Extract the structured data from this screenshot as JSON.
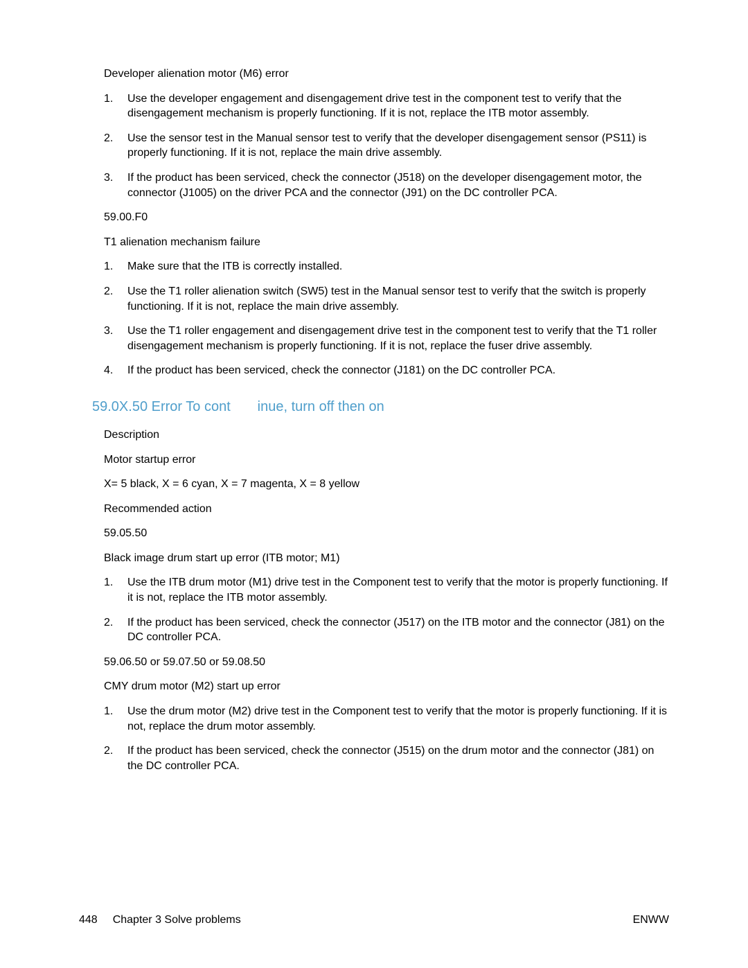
{
  "section1": {
    "title": "Developer alienation motor (M6) error",
    "items": [
      "Use the developer engagement and disengagement drive test in the component test to verify that the disengagement mechanism is properly functioning. If it is not, replace the ITB motor assembly.",
      "Use the sensor test in the Manual sensor test to verify that the developer disengagement sensor (PS11) is properly functioning. If it is not, replace the main drive assembly.",
      "If the product has been serviced, check the connector (J518) on the developer disengagement motor, the connector (J1005) on the driver PCA and the connector (J91) on the DC controller PCA."
    ]
  },
  "section2": {
    "code": "59.00.F0",
    "title": "T1 alienation mechanism failure",
    "items": [
      "Make sure that the ITB is correctly installed.",
      "Use the T1 roller alienation switch (SW5) test in the Manual sensor test to verify that the switch is properly functioning. If it is not, replace the main drive assembly.",
      "Use the T1 roller engagement and disengagement drive test in the component test to verify that the T1 roller disengagement mechanism is properly functioning. If it is not, replace the fuser drive assembly.",
      "If the product has been serviced, check the connector (J181) on the DC controller PCA."
    ]
  },
  "heading2": "59.0X.50 Error To cont       inue, turn off then on",
  "section3": {
    "desc_label": "Description",
    "desc_text1": "Motor startup error",
    "desc_text2": "X= 5 black, X = 6 cyan, X = 7 magenta, X = 8 yellow",
    "rec_label": "Recommended action"
  },
  "section4": {
    "code": "59.05.50",
    "title": "Black image drum start up error (ITB motor; M1)",
    "items": [
      "Use the ITB drum motor (M1) drive test in the Component test to verify that the motor is properly functioning. If it is not, replace the ITB motor assembly.",
      "If the product has been serviced, check the connector (J517) on the ITB motor and the connector (J81) on the DC controller PCA."
    ]
  },
  "section5": {
    "code": "59.06.50 or 59.07.50 or 59.08.50",
    "title": "CMY drum motor (M2) start up error",
    "items": [
      "Use the drum motor (M2) drive test in the Component test to verify that the motor is properly functioning. If it is not, replace the drum motor assembly.",
      "If the product has been serviced, check the connector (J515) on the drum motor and the connector (J81) on the DC controller PCA."
    ]
  },
  "footer": {
    "page": "448",
    "chapter": "Chapter 3   Solve problems",
    "right": "ENWW"
  }
}
